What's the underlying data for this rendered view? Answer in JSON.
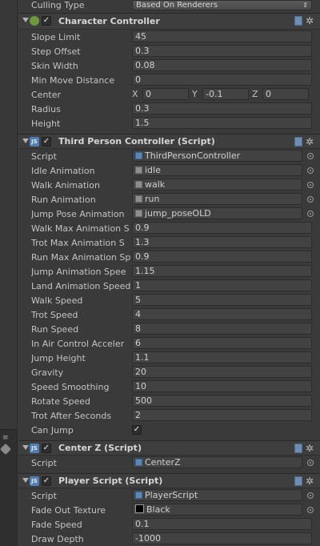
{
  "culling": {
    "label": "Culling Type",
    "value": "Based On Renderers",
    "arrows": "⇕"
  },
  "char_controller": {
    "title": "Character Controller",
    "fields": [
      {
        "label": "Slope Limit",
        "value": "45"
      },
      {
        "label": "Step Offset",
        "value": "0.3"
      },
      {
        "label": "Skin Width",
        "value": "0.08"
      },
      {
        "label": "Min Move Distance",
        "value": "0"
      }
    ],
    "center": {
      "label": "Center",
      "x_label": "X",
      "x": "0",
      "y_label": "Y",
      "y": "-0.1",
      "z_label": "Z",
      "z": "0"
    },
    "fields2": [
      {
        "label": "Radius",
        "value": "0.3"
      },
      {
        "label": "Height",
        "value": "1.5"
      }
    ]
  },
  "tpc": {
    "title": "Third Person Controller (Script)",
    "script": {
      "label": "Script",
      "value": "ThirdPersonController"
    },
    "anims": [
      {
        "label": "Idle Animation",
        "value": "idle"
      },
      {
        "label": "Walk Animation",
        "value": "walk"
      },
      {
        "label": "Run Animation",
        "value": "run"
      },
      {
        "label": "Jump Pose Animation",
        "value": "jump_poseOLD"
      }
    ],
    "fields": [
      {
        "label": "Walk Max Animation S",
        "value": "0.9"
      },
      {
        "label": "Trot Max Animation S",
        "value": "1.3"
      },
      {
        "label": "Run Max Animation Sp",
        "value": "0.9"
      },
      {
        "label": "Jump Animation Spee",
        "value": "1.15"
      },
      {
        "label": "Land Animation Speed",
        "value": "1"
      },
      {
        "label": "Walk Speed",
        "value": "5"
      },
      {
        "label": "Trot Speed",
        "value": "4"
      },
      {
        "label": "Run Speed",
        "value": "8"
      },
      {
        "label": "In Air Control Acceler",
        "value": "6"
      },
      {
        "label": "Jump Height",
        "value": "1.1"
      },
      {
        "label": "Gravity",
        "value": "20"
      },
      {
        "label": "Speed Smoothing",
        "value": "10"
      },
      {
        "label": "Rotate Speed",
        "value": "500"
      },
      {
        "label": "Trot After Seconds",
        "value": "2"
      }
    ],
    "can_jump": {
      "label": "Can Jump",
      "checked": "✓"
    }
  },
  "centerz": {
    "title": "Center Z (Script)",
    "script": {
      "label": "Script",
      "value": "CenterZ"
    }
  },
  "player": {
    "title": "Player Script (Script)",
    "script": {
      "label": "Script",
      "value": "PlayerScript"
    },
    "fade_texture": {
      "label": "Fade Out Texture",
      "value": "Black"
    },
    "fade_speed": {
      "label": "Fade Speed",
      "value": "0.1"
    },
    "draw_depth": {
      "label": "Draw Depth",
      "value": "-1000"
    }
  },
  "icons": {
    "check": "✓",
    "gear": "✲",
    "js": "JS",
    "menu_mini": "≡"
  },
  "colors": {
    "background": "#3a3a3a",
    "field": "#424242",
    "header": "#3e3e3e",
    "js_icon": "#4f7fb5"
  }
}
